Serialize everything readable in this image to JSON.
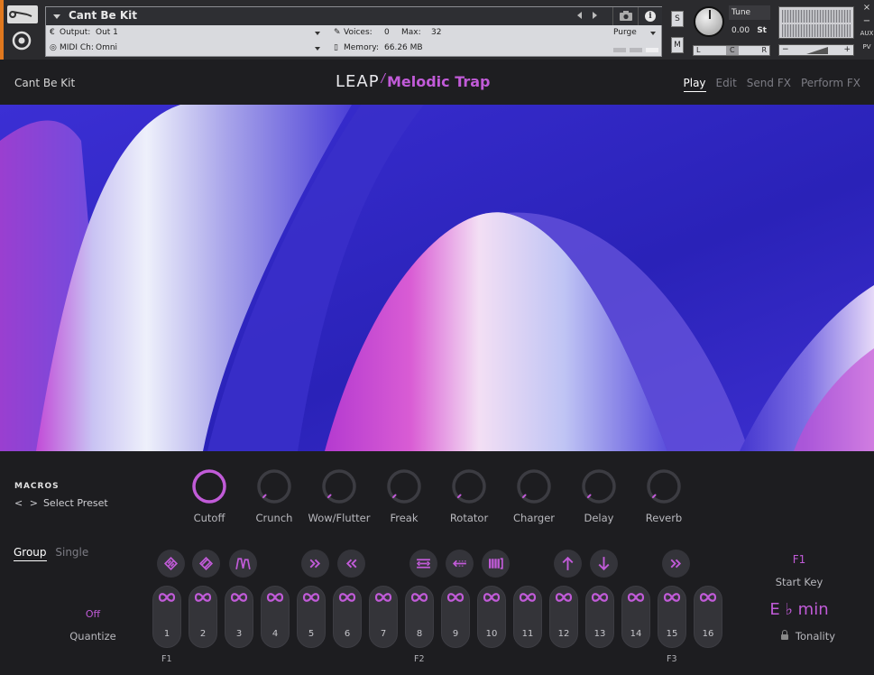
{
  "kontakt": {
    "instrument_name": "Cant Be Kit",
    "output_label": "Output:",
    "output_value": "Out 1",
    "voices_label": "Voices:",
    "voices_value": "0",
    "max_label": "Max:",
    "max_value": "32",
    "midi_label": "MIDI Ch:",
    "midi_value": "Omni",
    "memory_label": "Memory:",
    "memory_value": "66.26 MB",
    "purge_label": "Purge",
    "solo_label": "S",
    "mute_label": "M",
    "tune_label": "Tune",
    "tune_value": "0.00",
    "tune_unit": "St",
    "pan_left": "L",
    "pan_center": "C",
    "pan_right": "R",
    "vol_minus": "−",
    "vol_plus": "+",
    "side_close": "×",
    "side_min": "−",
    "side_aux": "AUX",
    "side_pv": "PV"
  },
  "leap": {
    "preset_name": "Cant Be Kit",
    "brand": "LEAP",
    "brand_slash": "/",
    "product": "Melodic Trap",
    "tabs": [
      {
        "label": "Play",
        "active": true
      },
      {
        "label": "Edit",
        "active": false
      },
      {
        "label": "Send FX",
        "active": false
      },
      {
        "label": "Perform FX",
        "active": false
      }
    ]
  },
  "macros": {
    "title": "MACROS",
    "select_chevrons": "< >",
    "select_preset": "Select Preset",
    "knobs": [
      {
        "label": "Cutoff",
        "active": true
      },
      {
        "label": "Crunch",
        "active": false
      },
      {
        "label": "Wow/Flutter",
        "active": false
      },
      {
        "label": "Freak",
        "active": false
      },
      {
        "label": "Rotator",
        "active": false
      },
      {
        "label": "Charger",
        "active": false
      },
      {
        "label": "Delay",
        "active": false
      },
      {
        "label": "Reverb",
        "active": false
      }
    ]
  },
  "perform": {
    "group_tab": "Group",
    "single_tab": "Single",
    "fx_icons": [
      "filter-icon",
      "filter-alt-icon",
      "envelope-icon",
      "fast-forward-icon",
      "rewind-icon",
      "stretch-icon",
      "reverse-icon",
      "stutter-icon",
      "pitch-up-icon",
      "pitch-down-icon",
      "fast-forward-icon"
    ],
    "pads": [
      "1",
      "2",
      "3",
      "4",
      "5",
      "6",
      "7",
      "8",
      "9",
      "10",
      "11",
      "12",
      "13",
      "14",
      "15",
      "16"
    ],
    "key_marks": [
      "F1",
      "F2",
      "F3"
    ],
    "quantize_value": "Off",
    "quantize_label": "Quantize",
    "start_key_value": "F1",
    "start_key_label": "Start Key",
    "tonality_value": "E ♭ min",
    "tonality_label": "Tonality"
  },
  "colors": {
    "accent": "#c15bd8",
    "panel": "#1d1d20",
    "kontakt_orange": "#e0781e"
  }
}
